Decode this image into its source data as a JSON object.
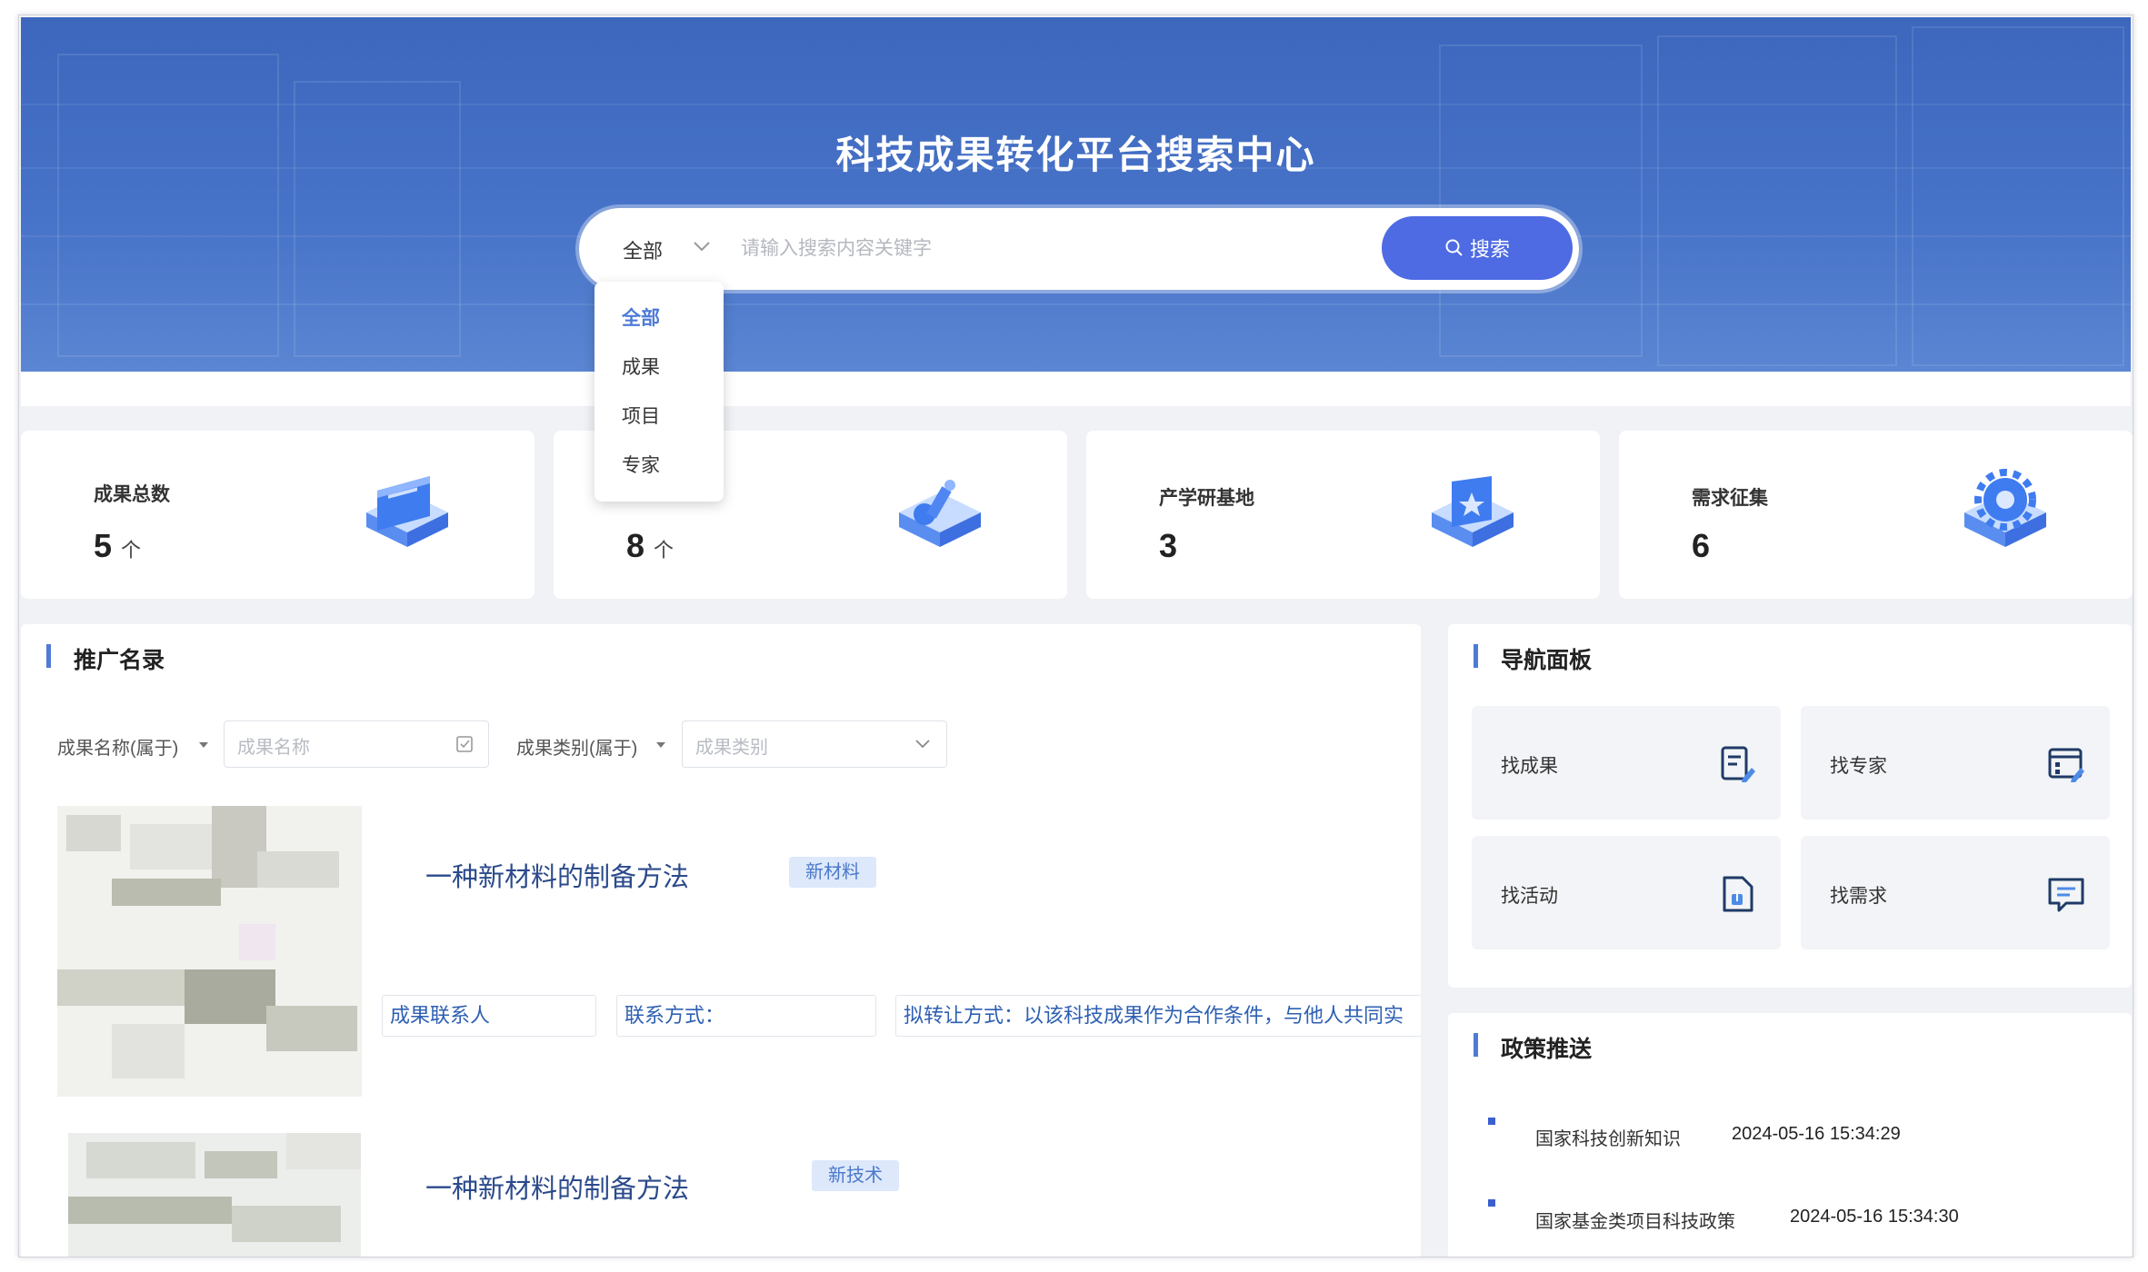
{
  "hero": {
    "title": "科技成果转化平台搜索中心",
    "search_scope": "全部",
    "search_placeholder": "请输入搜索内容关键字",
    "search_button": "搜索"
  },
  "scope_dropdown": {
    "options": [
      "全部",
      "成果",
      "项目",
      "专家"
    ],
    "selected": "全部"
  },
  "stats": [
    {
      "label": "成果总数",
      "value": "5",
      "unit": "个"
    },
    {
      "label": "",
      "value": "8",
      "unit": "个"
    },
    {
      "label": "产学研基地",
      "value": "3",
      "unit": ""
    },
    {
      "label": "需求征集",
      "value": "6",
      "unit": ""
    }
  ],
  "promo": {
    "title": "推广名录",
    "filter_name_label": "成果名称(属于)",
    "filter_name_placeholder": "成果名称",
    "filter_type_label": "成果类别(属于)",
    "filter_type_placeholder": "成果类别",
    "results": [
      {
        "title": "一种新材料的制备方法",
        "tag": "新材料",
        "contact": "成果联系人",
        "contact_method": "联系方式：",
        "transfer": "拟转让方式：以该科技成果作为合作条件，与他人共同实"
      },
      {
        "title": "一种新材料的制备方法",
        "tag": "新技术"
      }
    ]
  },
  "nav_panel": {
    "title": "导航面板",
    "tiles": [
      {
        "label": "找成果",
        "icon": "document-edit-icon"
      },
      {
        "label": "找专家",
        "icon": "calendar-edit-icon"
      },
      {
        "label": "找活动",
        "icon": "file-upload-icon"
      },
      {
        "label": "找需求",
        "icon": "message-icon"
      }
    ]
  },
  "policy": {
    "title": "政策推送",
    "items": [
      {
        "text": "国家科技创新知识",
        "date": "2024-05-16 15:34:29"
      },
      {
        "text": "国家基金类项目科技政策",
        "date": "2024-05-16 15:34:30"
      }
    ]
  },
  "colors": {
    "hero_blue": "#4672c8",
    "accent": "#4e6be3",
    "link_blue": "#2b4a8b",
    "tag_bg": "#dde8fb"
  }
}
